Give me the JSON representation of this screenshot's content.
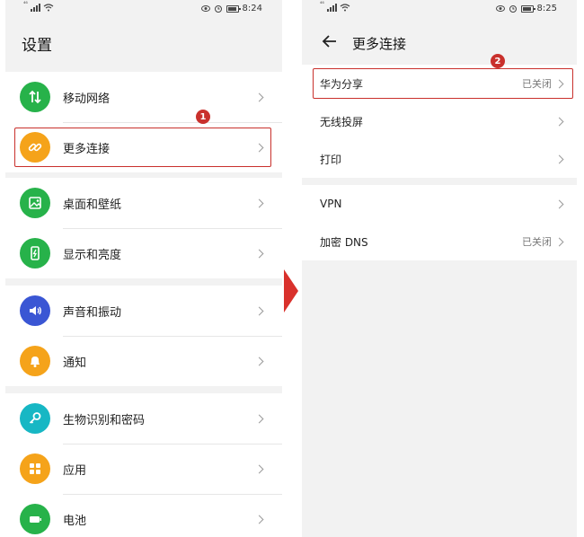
{
  "left": {
    "status": {
      "signal_tag": "⁴⁶",
      "time": "8:24"
    },
    "title": "设置",
    "items": [
      {
        "label": "移动网络",
        "icon": "mobile-network-icon",
        "color": "#27b24a"
      },
      {
        "label": "更多连接",
        "icon": "link-icon",
        "color": "#f5a31a"
      },
      {
        "label": "桌面和壁纸",
        "icon": "wallpaper-icon",
        "color": "#27b24a"
      },
      {
        "label": "显示和亮度",
        "icon": "display-icon",
        "color": "#27b24a"
      },
      {
        "label": "声音和振动",
        "icon": "sound-icon",
        "color": "#3a56d4"
      },
      {
        "label": "通知",
        "icon": "bell-icon",
        "color": "#f5a31a"
      },
      {
        "label": "生物识别和密码",
        "icon": "key-icon",
        "color": "#17b7c4"
      },
      {
        "label": "应用",
        "icon": "apps-icon",
        "color": "#f5a31a"
      },
      {
        "label": "电池",
        "icon": "battery-icon",
        "color": "#27b24a"
      }
    ],
    "badge": "1"
  },
  "right": {
    "status": {
      "signal_tag": "⁴⁶",
      "time": "8:25"
    },
    "title": "更多连接",
    "items": [
      {
        "label": "华为分享",
        "value": "已关闭"
      },
      {
        "label": "无线投屏",
        "value": ""
      },
      {
        "label": "打印",
        "value": ""
      },
      {
        "label": "VPN",
        "value": ""
      },
      {
        "label": "加密 DNS",
        "value": "已关闭"
      }
    ],
    "badge": "2"
  },
  "colors": {
    "highlight": "#c9302c",
    "arrow": "#d9312c"
  }
}
